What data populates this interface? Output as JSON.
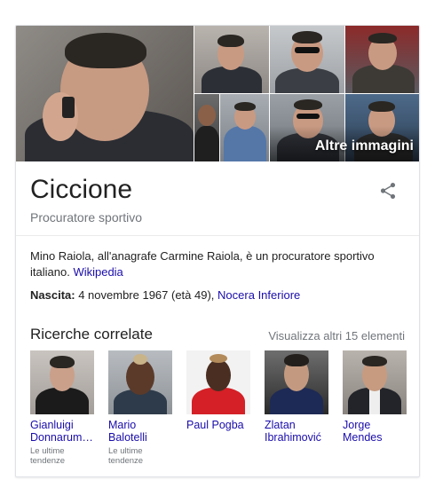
{
  "panel": {
    "title": "Ciccione",
    "subtitle": "Procuratore sportivo",
    "more_images_label": "Altre immagini",
    "share_icon": "share-icon"
  },
  "description": {
    "text": "Mino Raiola, all'anagrafe Carmine Raiola, è un procuratore sportivo italiano.",
    "source_link": "Wikipedia"
  },
  "facts": {
    "birth_label": "Nascita:",
    "birth_value": "4 novembre 1967 (età 49),",
    "birth_place": "Nocera Inferiore"
  },
  "related": {
    "heading": "Ricerche correlate",
    "view_more": "Visualizza altri 15 elementi",
    "items": [
      {
        "name_line1": "Gianluigi",
        "name_line2": "Donnarum…",
        "tag_line1": "Le ultime",
        "tag_line2": "tendenze"
      },
      {
        "name_line1": "Mario",
        "name_line2": "Balotelli",
        "tag_line1": "Le ultime",
        "tag_line2": "tendenze"
      },
      {
        "name_line1": "Paul Pogba",
        "name_line2": "",
        "tag_line1": "",
        "tag_line2": ""
      },
      {
        "name_line1": "Zlatan",
        "name_line2": "Ibrahimović",
        "tag_line1": "",
        "tag_line2": ""
      },
      {
        "name_line1": "Jorge",
        "name_line2": "Mendes",
        "tag_line1": "",
        "tag_line2": ""
      }
    ]
  },
  "colors": {
    "link": "#1a0dab",
    "muted": "#70757a",
    "border": "#dfe1e5"
  }
}
